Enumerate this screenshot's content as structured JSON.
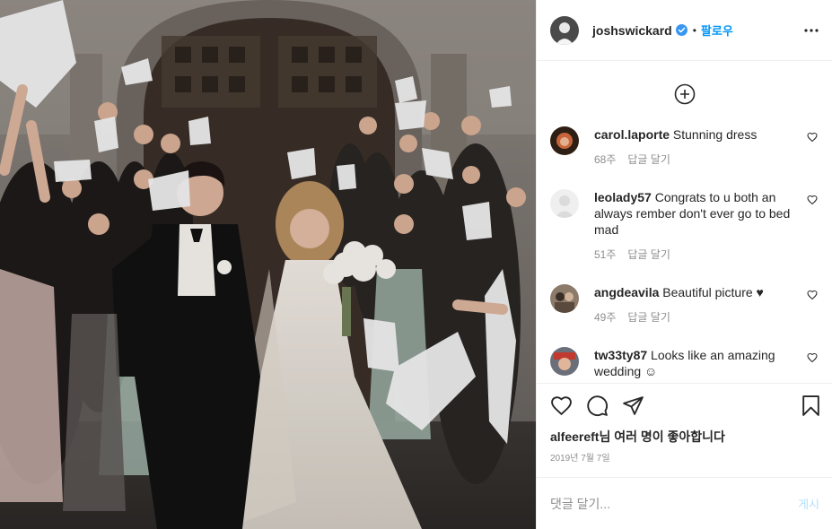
{
  "header": {
    "username": "joshswickard",
    "separator": "•",
    "follow_label": "팔로우"
  },
  "comments": [
    {
      "username": "carol.laporte",
      "text": "Stunning dress",
      "time": "68주",
      "reply_label": "답글 달기"
    },
    {
      "username": "leolady57",
      "text": "Congrats to u both an always rember don't ever go to bed mad",
      "time": "51주",
      "reply_label": "답글 달기"
    },
    {
      "username": "angdeavila",
      "text": "Beautiful picture ♥",
      "time": "49주",
      "reply_label": "답글 달기"
    },
    {
      "username": "tw33ty87",
      "text": "Looks like an amazing wedding ☺"
    }
  ],
  "likes": {
    "user": "alfeereft",
    "suffix": "님 여러 명이 좋아합니다"
  },
  "date": "2019년 7월 7일",
  "add_comment": {
    "placeholder": "댓글 달기...",
    "post_label": "게시"
  },
  "colors": {
    "accent": "#0095f6",
    "muted": "#8e8e8e",
    "post_disabled": "#b2dffc"
  }
}
